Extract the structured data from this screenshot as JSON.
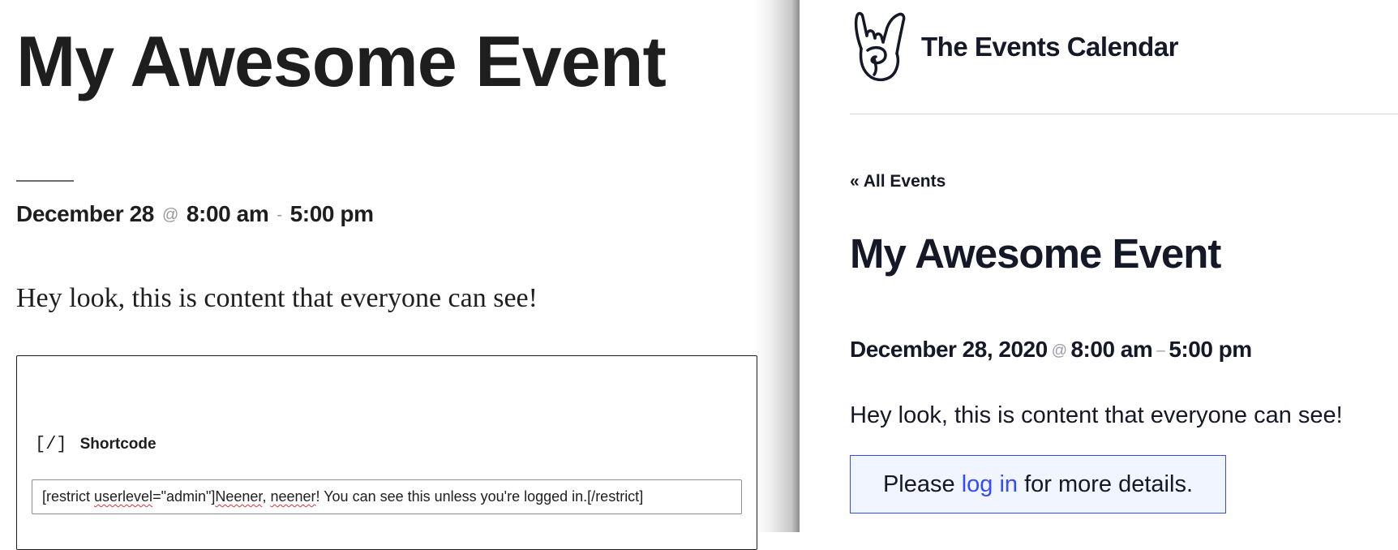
{
  "editor": {
    "title": "My Awesome Event",
    "date": "December 28",
    "at": "@",
    "start_time": "8:00 am",
    "dash": "-",
    "end_time": "5:00 pm",
    "paragraph": "Hey look, this is content that everyone can see!",
    "shortcode_block": {
      "icon": "shortcode-icon",
      "icon_glyph": "[/]",
      "label": "Shortcode",
      "value_parts": [
        "[restrict ",
        "userlevel",
        "=\"admin\"]",
        "Neener",
        ", ",
        "neener",
        "! You can see this unless you're logged in.[/restrict]"
      ]
    }
  },
  "frontend": {
    "logo_icon": "rock-hand-icon",
    "brand": "The Events Calendar",
    "back_link": "« All Events",
    "title": "My Awesome Event",
    "date": "December 28, 2020",
    "at": "@",
    "start_time": "8:00 am",
    "dash": "–",
    "end_time": "5:00 pm",
    "paragraph": "Hey look, this is content that everyone can see!",
    "notice": {
      "before": "Please ",
      "link": "log in",
      "after": " for more details."
    }
  },
  "colors": {
    "editor_text": "#1e1e1e",
    "frontend_text": "#141827",
    "accent_blue": "#334aff",
    "notice_bg": "#f0f5ff",
    "spellcheck_red": "#d63638"
  }
}
